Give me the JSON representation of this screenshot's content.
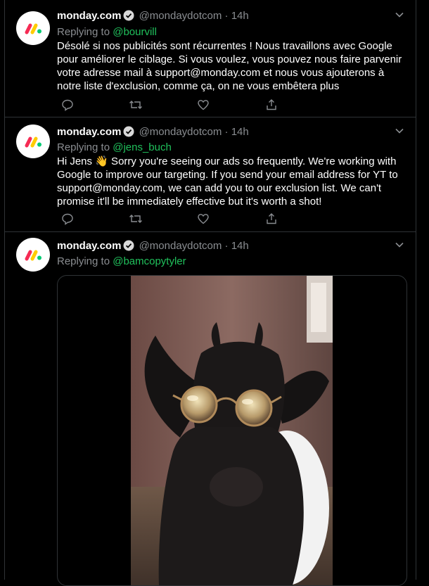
{
  "author": {
    "name": "monday.com",
    "handle": "@mondaydotcom",
    "separator": "·",
    "verified": true
  },
  "replying_to_label": "Replying to",
  "tweets": [
    {
      "time": "14h",
      "reply_to": "@bourvill",
      "text": "Désolé si nos publicités sont récurrentes ! Nous travaillons avec Google pour améliorer le ciblage. Si vous voulez, vous pouvez nous faire parvenir votre adresse mail à support@monday.com et nous vous ajouterons à notre liste d'exclusion, comme ça, on ne vous embêtera plus"
    },
    {
      "time": "14h",
      "reply_to": "@jens_buch",
      "text_before": "Hi Jens",
      "emoji": "👋",
      "text_after": " Sorry you're seeing our ads so frequently. We're working with Google to improve our targeting. If you send your email address for YT to support@monday.com, we can add you to our exclusion list. We can't promise it'll be immediately effective but it's worth a shot!"
    },
    {
      "time": "14h",
      "reply_to": "@bamcopytyler",
      "media": "video-thumbnail-goat-with-round-sunglasses"
    }
  ],
  "colors": {
    "background": "#000000",
    "divider": "#2f3336",
    "secondary_text": "#8a8d91",
    "mention": "#20c15c",
    "verified_badge": "#d9d9d9"
  },
  "icons": [
    "monday-logo-icon",
    "verified-badge-icon",
    "chevron-down-icon",
    "reply-icon",
    "retweet-icon",
    "like-icon",
    "share-icon"
  ]
}
